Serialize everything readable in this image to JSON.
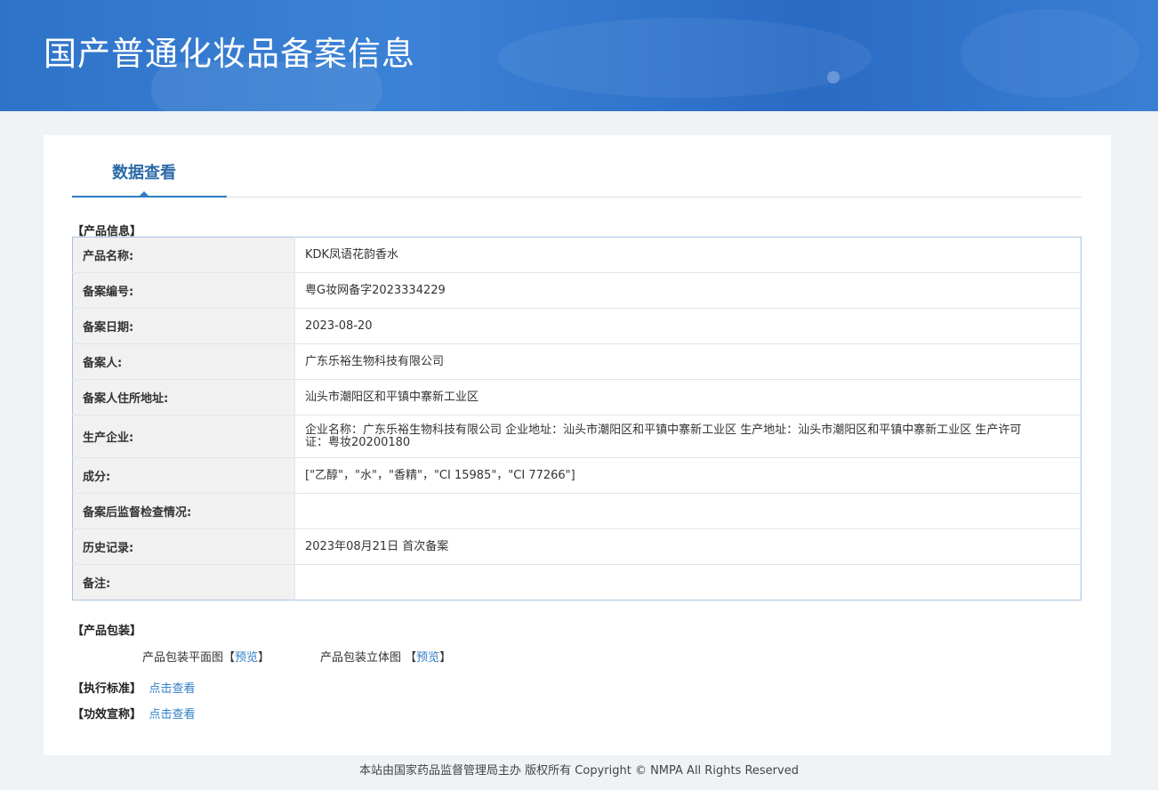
{
  "header": {
    "title": "国产普通化妆品备案信息"
  },
  "tab": {
    "label": "数据查看"
  },
  "sections": {
    "product_info": "【产品信息】",
    "packaging": "【产品包装】",
    "standard": "【执行标准】",
    "efficacy": "【功效宣称】"
  },
  "info_rows": [
    {
      "label": "产品名称:",
      "value": "KDK凤语花韵香水"
    },
    {
      "label": "备案编号:",
      "value": "粤G妆网备字2023334229"
    },
    {
      "label": "备案日期:",
      "value": "2023-08-20"
    },
    {
      "label": "备案人:",
      "value": "广东乐裕生物科技有限公司"
    },
    {
      "label": "备案人住所地址:",
      "value": "汕头市潮阳区和平镇中寨新工业区"
    },
    {
      "label": "生产企业:",
      "value": "企业名称：广东乐裕生物科技有限公司 企业地址：汕头市潮阳区和平镇中寨新工业区 生产地址：汕头市潮阳区和平镇中寨新工业区 生产许可证：粤妆20200180"
    },
    {
      "label": "成分:",
      "value": "[\"乙醇\"，\"水\"，\"香精\"，\"CI 15985\"，\"CI 77266\"]"
    },
    {
      "label": "备案后监督检查情况:",
      "value": ""
    },
    {
      "label": "历史记录:",
      "value": "2023年08月21日 首次备案"
    },
    {
      "label": "备注:",
      "value": ""
    }
  ],
  "packaging": {
    "flat_label": "产品包装平面图",
    "flat_link": "预览",
    "stereo_label": "产品包装立体图",
    "stereo_link": "预览",
    "bracket_open": "【",
    "bracket_close": "】"
  },
  "links": {
    "standard_link": "点击查看",
    "efficacy_link": "点击查看"
  },
  "footer": {
    "text": "本站由国家药品监督管理局主办 版权所有 Copyright © NMPA All Rights Reserved"
  }
}
